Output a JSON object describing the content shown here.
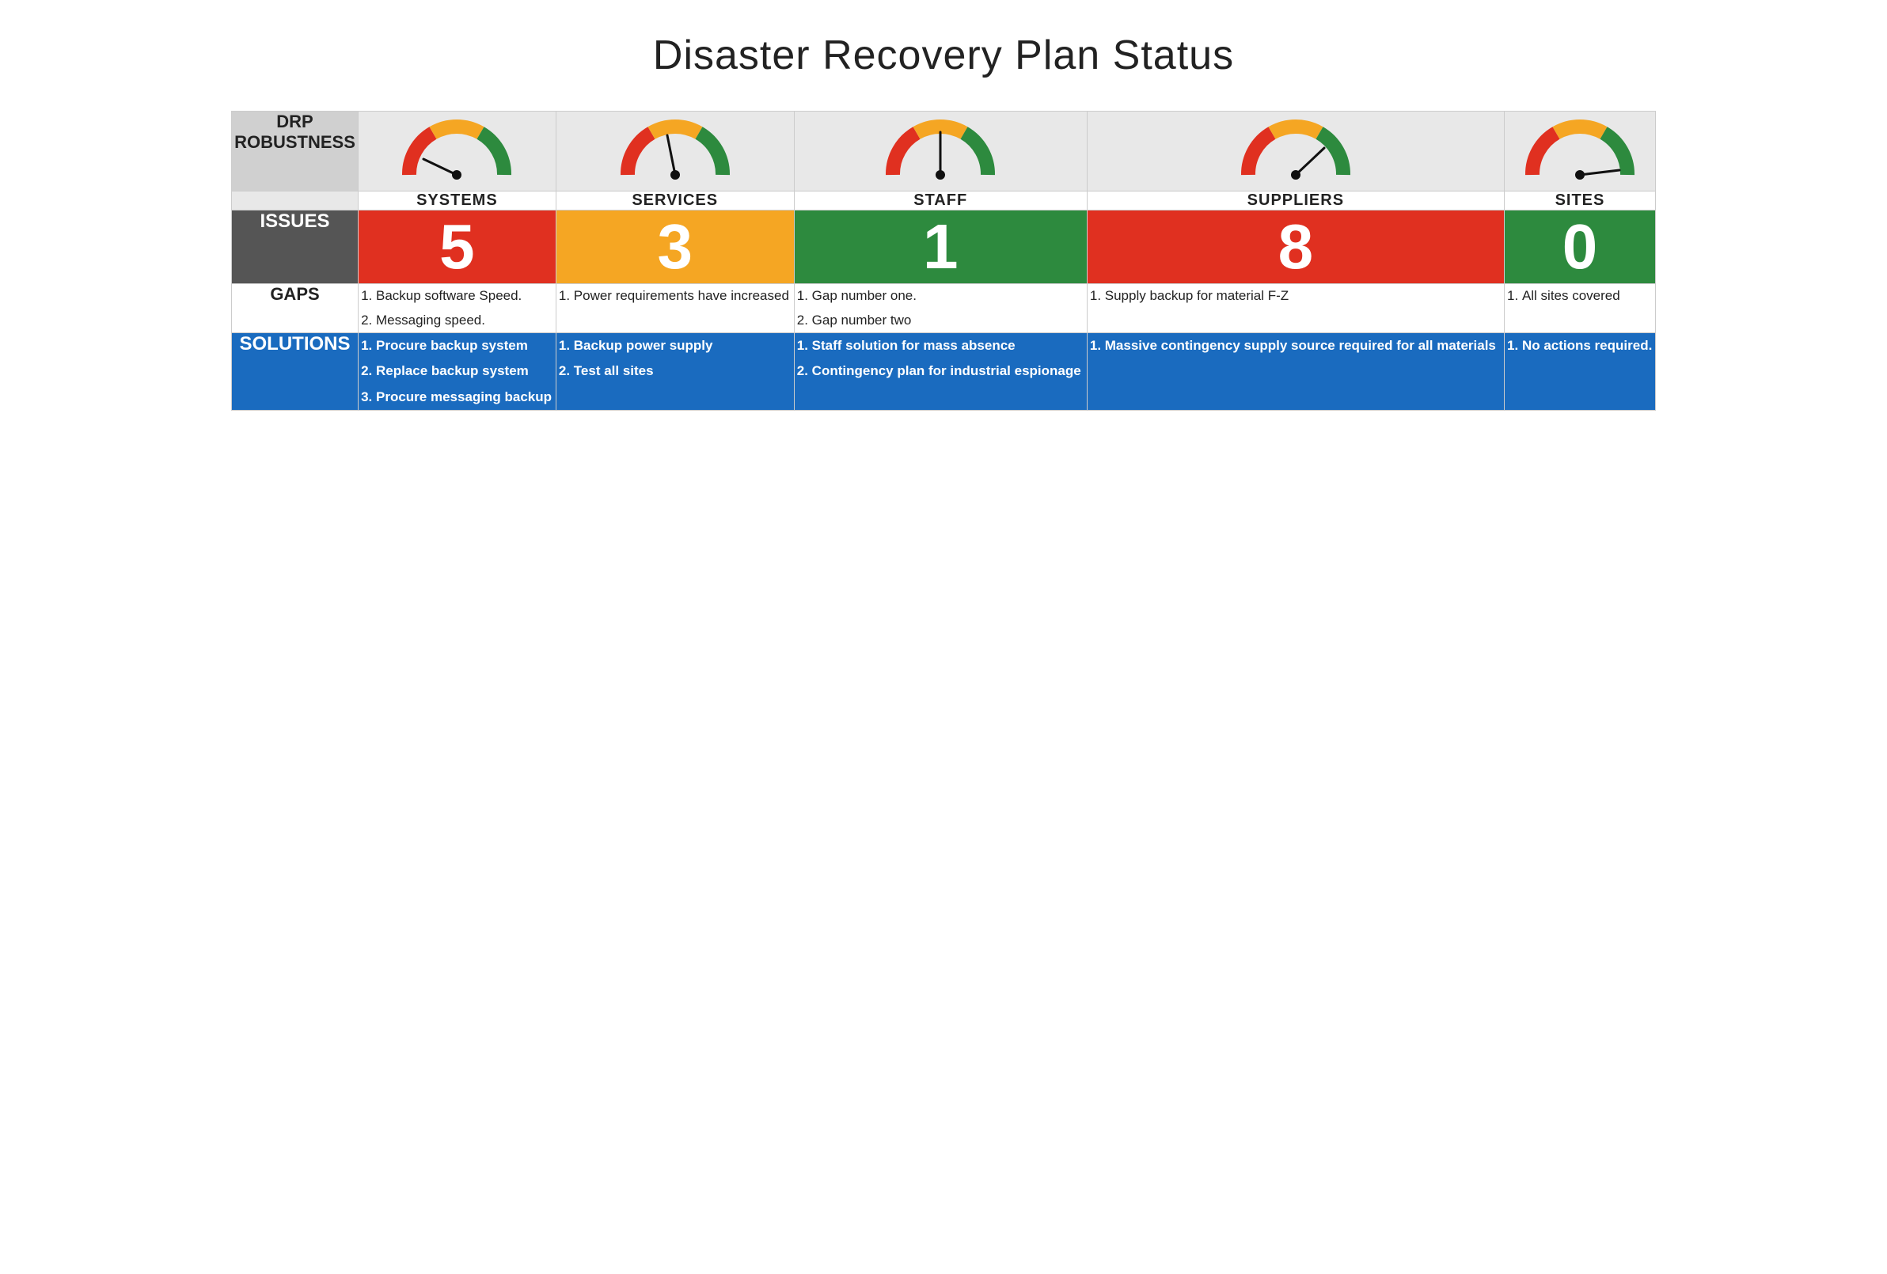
{
  "title": "Disaster Recovery Plan Status",
  "columns": [
    "SYSTEMS",
    "SERVICES",
    "STAFF",
    "SUPPLIERS",
    "SITES"
  ],
  "drp_label": "DRP\nROBUSTNESS",
  "gauges": [
    {
      "id": "systems",
      "needle_angle": -120
    },
    {
      "id": "services",
      "needle_angle": -90
    },
    {
      "id": "staff",
      "needle_angle": -60
    },
    {
      "id": "suppliers",
      "needle_angle": -30
    },
    {
      "id": "sites",
      "needle_angle": 0
    }
  ],
  "issues": {
    "label": "ISSUES",
    "values": [
      {
        "number": "5",
        "color": "bg-red"
      },
      {
        "number": "3",
        "color": "bg-orange"
      },
      {
        "number": "1",
        "color": "bg-green"
      },
      {
        "number": "8",
        "color": "bg-red"
      },
      {
        "number": "0",
        "color": "bg-green"
      }
    ]
  },
  "gaps": {
    "label": "GAPS",
    "cells": [
      {
        "items": [
          "Backup software Speed.",
          "Messaging speed."
        ]
      },
      {
        "items": [
          "Power requirements have increased"
        ]
      },
      {
        "items": [
          "Gap number one.",
          "Gap number two"
        ]
      },
      {
        "items": [
          "Supply backup for material F-Z"
        ]
      },
      {
        "items": [
          "All sites covered"
        ]
      }
    ]
  },
  "solutions": {
    "label": "SOLUTIONS",
    "cells": [
      {
        "items": [
          "Procure backup system",
          "Replace backup system",
          "Procure messaging backup"
        ]
      },
      {
        "items": [
          "Backup power supply",
          "Test all sites"
        ]
      },
      {
        "items": [
          "Staff solution for mass absence",
          "Contingency plan for industrial espionage"
        ]
      },
      {
        "items": [
          "Massive contingency supply source required for all materials"
        ]
      },
      {
        "items": [
          "No actions required."
        ]
      }
    ]
  }
}
